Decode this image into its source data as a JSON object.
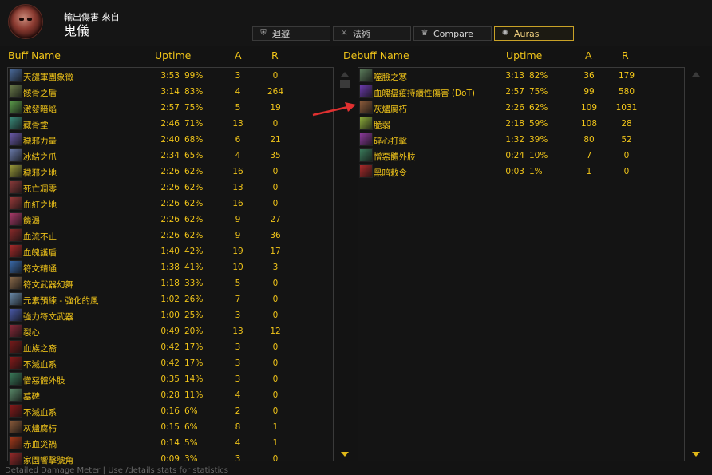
{
  "header": {
    "subtitle": "輸出傷害 來自",
    "title": "鬼儀"
  },
  "tabs": [
    {
      "label": "迴避",
      "icon": "shield-icon",
      "active": false
    },
    {
      "label": "法術",
      "icon": "swords-icon",
      "active": false
    },
    {
      "label": "Compare",
      "icon": "crown-icon",
      "active": false
    },
    {
      "label": "Auras",
      "icon": "aura-icon",
      "active": true
    }
  ],
  "buff_columns": {
    "name": "Buff Name",
    "uptime": "Uptime",
    "a": "A",
    "r": "R"
  },
  "debuff_columns": {
    "name": "Debuff Name",
    "uptime": "Uptime",
    "a": "A",
    "r": "R"
  },
  "buffs": [
    {
      "name": "天譴軍團象徵",
      "time": "3:53",
      "pct": "99%",
      "a": "3",
      "r": "0",
      "color": "#4a6a9a"
    },
    {
      "name": "骸骨之盾",
      "time": "3:14",
      "pct": "83%",
      "a": "4",
      "r": "264",
      "color": "#6a7a4a"
    },
    {
      "name": "激發暗焰",
      "time": "2:57",
      "pct": "75%",
      "a": "5",
      "r": "19",
      "color": "#5a9a4a"
    },
    {
      "name": "藏骨堂",
      "time": "2:46",
      "pct": "71%",
      "a": "13",
      "r": "0",
      "color": "#3a8a7a"
    },
    {
      "name": "穢邪力量",
      "time": "2:40",
      "pct": "68%",
      "a": "6",
      "r": "21",
      "color": "#6a5aaa"
    },
    {
      "name": "冰結之爪",
      "time": "2:34",
      "pct": "65%",
      "a": "4",
      "r": "35",
      "color": "#6a7aaa"
    },
    {
      "name": "穢邪之地",
      "time": "2:26",
      "pct": "62%",
      "a": "16",
      "r": "0",
      "color": "#9a9a3a"
    },
    {
      "name": "死亡凋零",
      "time": "2:26",
      "pct": "62%",
      "a": "13",
      "r": "0",
      "color": "#8a3a3a"
    },
    {
      "name": "血紅之地",
      "time": "2:26",
      "pct": "62%",
      "a": "16",
      "r": "0",
      "color": "#9a3a3a"
    },
    {
      "name": "饑渴",
      "time": "2:26",
      "pct": "62%",
      "a": "9",
      "r": "27",
      "color": "#aa3a6a"
    },
    {
      "name": "血流不止",
      "time": "2:26",
      "pct": "62%",
      "a": "9",
      "r": "36",
      "color": "#8a2a2a"
    },
    {
      "name": "血魄護盾",
      "time": "1:40",
      "pct": "42%",
      "a": "19",
      "r": "17",
      "color": "#aa2a2a"
    },
    {
      "name": "符文精通",
      "time": "1:38",
      "pct": "41%",
      "a": "10",
      "r": "3",
      "color": "#3a6aaa"
    },
    {
      "name": "符文武器幻舞",
      "time": "1:18",
      "pct": "33%",
      "a": "5",
      "r": "0",
      "color": "#8a6a4a"
    },
    {
      "name": "元素預練 - 強化的風",
      "time": "1:02",
      "pct": "26%",
      "a": "7",
      "r": "0",
      "color": "#6a8aaa"
    },
    {
      "name": "強力符文武器",
      "time": "1:00",
      "pct": "25%",
      "a": "3",
      "r": "0",
      "color": "#4a5aaa"
    },
    {
      "name": "裂心",
      "time": "0:49",
      "pct": "20%",
      "a": "13",
      "r": "12",
      "color": "#8a2a3a"
    },
    {
      "name": "血族之裔",
      "time": "0:42",
      "pct": "17%",
      "a": "3",
      "r": "0",
      "color": "#7a1a1a"
    },
    {
      "name": "不滅血系",
      "time": "0:42",
      "pct": "17%",
      "a": "3",
      "r": "0",
      "color": "#8a1a1a"
    },
    {
      "name": "憎惡體外肢",
      "time": "0:35",
      "pct": "14%",
      "a": "3",
      "r": "0",
      "color": "#3a7a5a"
    },
    {
      "name": "墓碑",
      "time": "0:28",
      "pct": "11%",
      "a": "4",
      "r": "0",
      "color": "#5a8a6a"
    },
    {
      "name": "不滅血系",
      "time": "0:16",
      "pct": "6%",
      "a": "2",
      "r": "0",
      "color": "#8a1a1a"
    },
    {
      "name": "灰燼腐朽",
      "time": "0:15",
      "pct": "6%",
      "a": "8",
      "r": "1",
      "color": "#8a5a3a"
    },
    {
      "name": "赤血災禍",
      "time": "0:14",
      "pct": "5%",
      "a": "4",
      "r": "1",
      "color": "#aa3a1a"
    },
    {
      "name": "家園響擊號角",
      "time": "0:09",
      "pct": "3%",
      "a": "3",
      "r": "0",
      "color": "#9a2a2a"
    }
  ],
  "debuffs": [
    {
      "name": "噬臉之寒",
      "time": "3:13",
      "pct": "82%",
      "a": "36",
      "r": "179",
      "color": "#5a7a5a"
    },
    {
      "name": "血魄瘟疫持續性傷害 (DoT)",
      "time": "2:57",
      "pct": "75%",
      "a": "99",
      "r": "580",
      "color": "#6a3aaa"
    },
    {
      "name": "灰燼腐朽",
      "time": "2:26",
      "pct": "62%",
      "a": "109",
      "r": "1031",
      "color": "#8a5a3a"
    },
    {
      "name": "脆弱",
      "time": "2:18",
      "pct": "59%",
      "a": "108",
      "r": "28",
      "color": "#8aaa3a"
    },
    {
      "name": "碎心打擊",
      "time": "1:32",
      "pct": "39%",
      "a": "80",
      "r": "52",
      "color": "#8a3a9a"
    },
    {
      "name": "憎惡體外肢",
      "time": "0:24",
      "pct": "10%",
      "a": "7",
      "r": "0",
      "color": "#3a7a5a"
    },
    {
      "name": "黑暗敕令",
      "time": "0:03",
      "pct": "1%",
      "a": "1",
      "r": "0",
      "color": "#aa2a2a"
    }
  ],
  "footer": "Detailed Damage Meter | Use /details stats for statistics",
  "accent": "#f0c419",
  "arrow_color": "#e03030"
}
